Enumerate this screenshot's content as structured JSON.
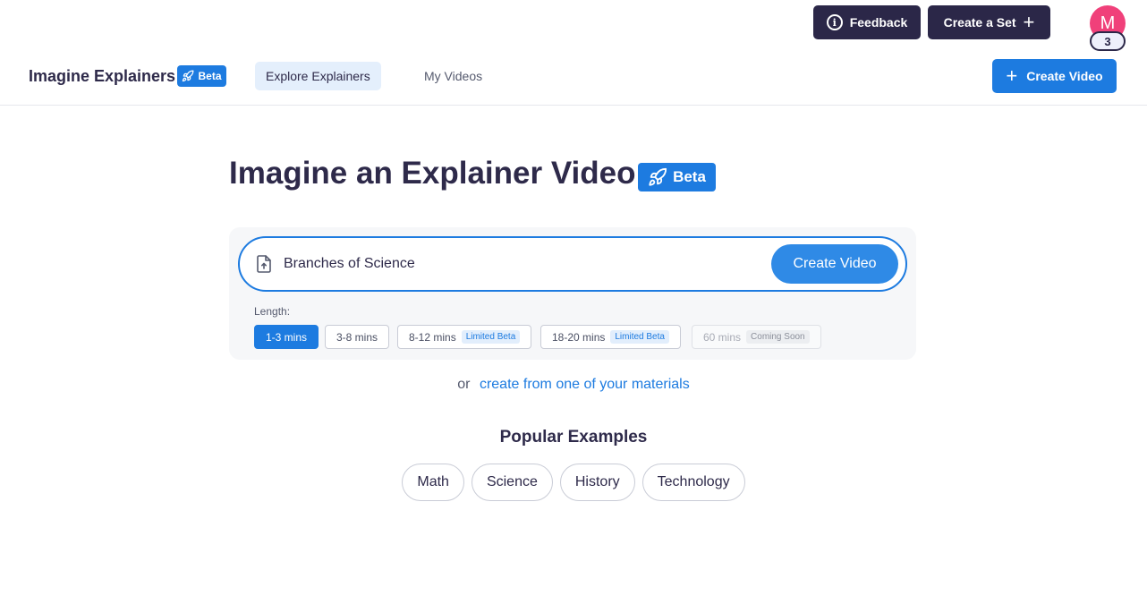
{
  "topbar": {
    "feedback_label": "Feedback",
    "create_set_label": "Create a Set",
    "avatar_initial": "M",
    "avatar_count": "3"
  },
  "nav": {
    "brand": "Imagine Explainers",
    "beta_label": "Beta",
    "tabs": [
      {
        "label": "Explore Explainers",
        "active": true
      },
      {
        "label": "My Videos",
        "active": false
      }
    ],
    "create_video_label": "Create Video"
  },
  "hero": {
    "title": "Imagine an Explainer Video",
    "beta_label": "Beta"
  },
  "prompt": {
    "value": "Branches of Science",
    "button_label": "Create Video"
  },
  "length": {
    "label": "Length:",
    "options": [
      {
        "label": "1-3 mins",
        "tag": "",
        "state": "active"
      },
      {
        "label": "3-8 mins",
        "tag": "",
        "state": "normal"
      },
      {
        "label": "8-12 mins",
        "tag": "Limited Beta",
        "state": "normal"
      },
      {
        "label": "18-20 mins",
        "tag": "Limited Beta",
        "state": "normal"
      },
      {
        "label": "60 mins",
        "tag": "Coming Soon",
        "state": "disabled"
      }
    ]
  },
  "materials": {
    "or_text": "or",
    "link_text": "create from one of your materials"
  },
  "examples": {
    "title": "Popular Examples",
    "items": [
      "Math",
      "Science",
      "History",
      "Technology"
    ]
  },
  "colors": {
    "primary": "#1d7be0",
    "dark": "#2b2748",
    "avatar": "#f0407a"
  }
}
